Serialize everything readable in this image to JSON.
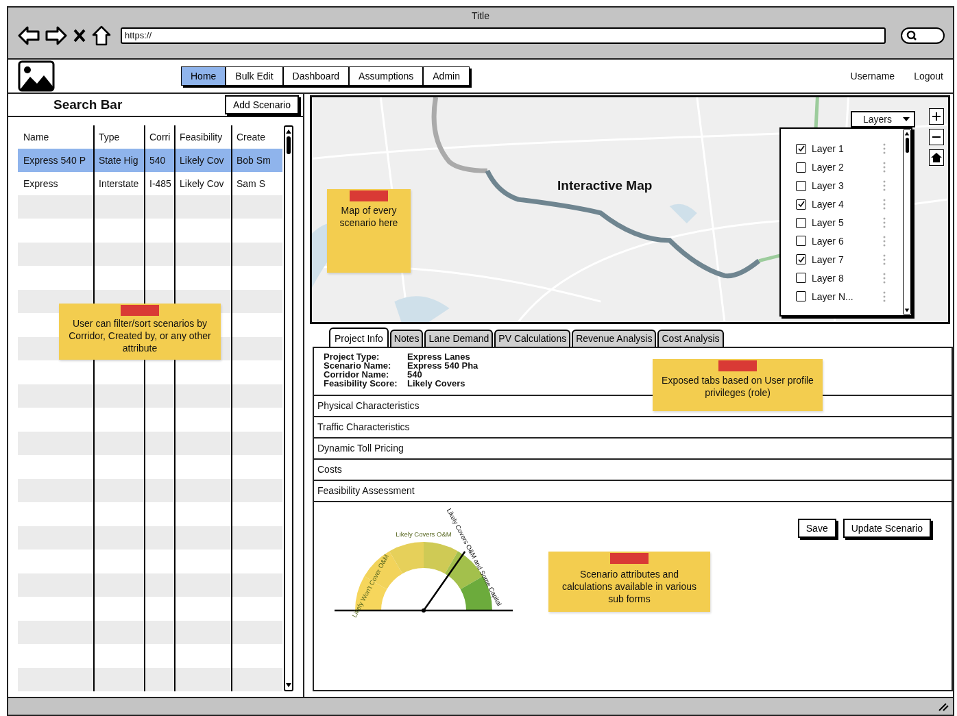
{
  "browser": {
    "title": "Title",
    "url": "https://"
  },
  "nav": {
    "tabs": [
      {
        "label": "Home",
        "selected": true
      },
      {
        "label": "Bulk Edit",
        "selected": false
      },
      {
        "label": "Dashboard",
        "selected": false
      },
      {
        "label": "Assumptions",
        "selected": false
      },
      {
        "label": "Admin",
        "selected": false
      }
    ],
    "username": "Username",
    "logout": "Logout"
  },
  "scenarios": {
    "search_label": "Search Bar",
    "add_button": "Add Scenario",
    "columns": [
      "Name",
      "Type",
      "Corri",
      "Feasibility",
      "Create"
    ],
    "rows": [
      {
        "cells": [
          "Express 540 P",
          "State Hig",
          "540",
          "Likely Cov",
          "Bob Sm"
        ],
        "selected": true
      },
      {
        "cells": [
          "Express",
          "Interstate",
          "I-485",
          "Likely Cov",
          "Sam S"
        ],
        "selected": false
      }
    ],
    "note": "User can filter/sort scenarios by Corridor, Created by, or any other attribute"
  },
  "map": {
    "title": "Interactive Map",
    "note": "Map of every scenario here",
    "layers_dropdown": "Layers",
    "layers": [
      {
        "label": "Layer 1",
        "checked": true
      },
      {
        "label": "Layer 2",
        "checked": false
      },
      {
        "label": "Layer 3",
        "checked": false
      },
      {
        "label": "Layer 4",
        "checked": true
      },
      {
        "label": "Layer 5",
        "checked": false
      },
      {
        "label": "Layer 6",
        "checked": false
      },
      {
        "label": "Layer 7",
        "checked": true
      },
      {
        "label": "Layer 8",
        "checked": false
      },
      {
        "label": "Layer N...",
        "checked": false
      }
    ]
  },
  "detail": {
    "tabs": [
      {
        "label": "Project Info",
        "selected": true
      },
      {
        "label": "Notes",
        "selected": false
      },
      {
        "label": "Lane Demand",
        "selected": false
      },
      {
        "label": "PV Calculations",
        "selected": false
      },
      {
        "label": "Revenue Analysis",
        "selected": false
      },
      {
        "label": "Cost Analysis",
        "selected": false
      }
    ],
    "tabs_note": "Exposed tabs based on User profile privileges (role)",
    "project_info": [
      {
        "label": "Project Type:",
        "value": "Express Lanes"
      },
      {
        "label": "Scenario Name:",
        "value": "Express 540 Pha"
      },
      {
        "label": "Corridor Name:",
        "value": "540"
      },
      {
        "label": "Feasibility Score:",
        "value": "Likely Covers"
      }
    ],
    "sections": [
      "Physical Characteristics",
      "Traffic Characteristics",
      "Dynamic Toll Pricing",
      "Costs",
      "Feasibility Assessment"
    ],
    "gauge_labels": [
      "Likely Won't Cover O&M",
      "Likely Covers O&M",
      "Likely Covers O&M and Some Capital"
    ],
    "gauge_note": "Scenario attributes and calculations available in various sub forms",
    "buttons": [
      "Save",
      "Update Scenario"
    ]
  }
}
